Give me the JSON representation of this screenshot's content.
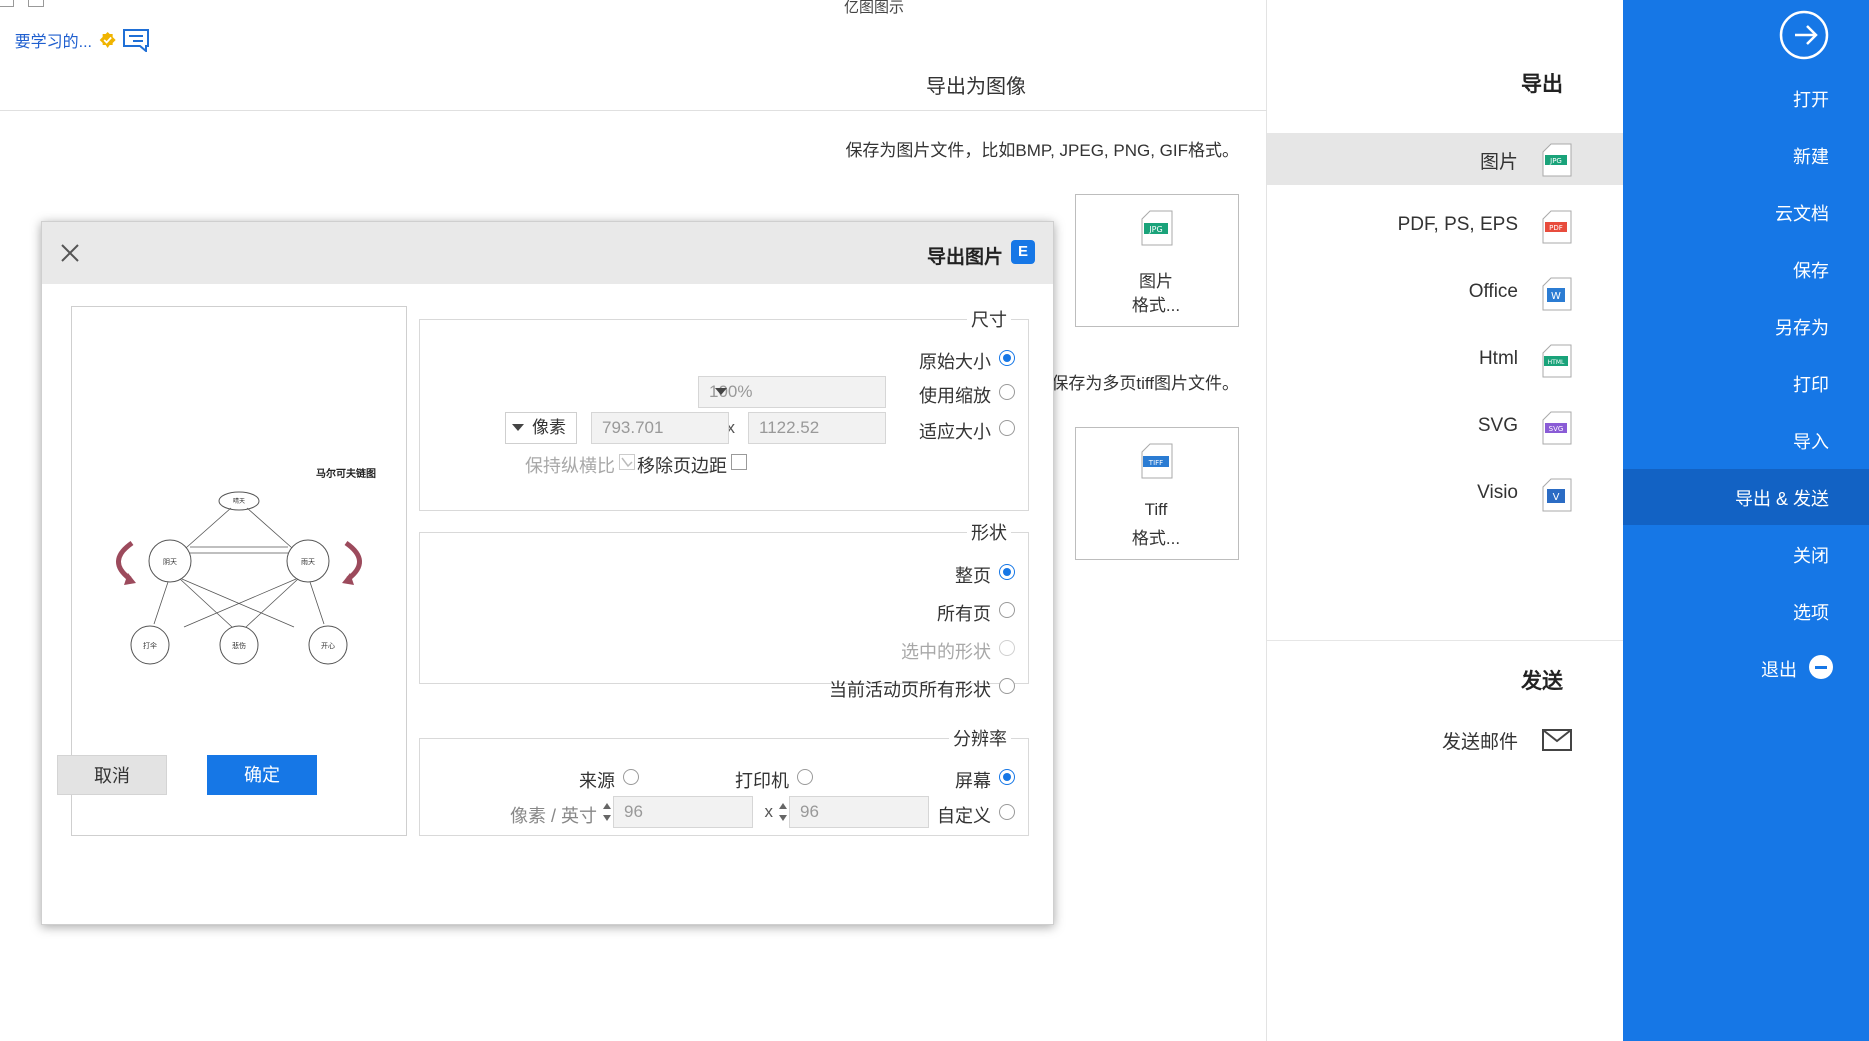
{
  "window": {
    "title": "亿图图示"
  },
  "top_bar": {
    "learn_link": "要学习的..."
  },
  "sidebar": {
    "items": [
      {
        "label": "打开"
      },
      {
        "label": "新建"
      },
      {
        "label": "云文档"
      },
      {
        "label": "保存"
      },
      {
        "label": "另存为"
      },
      {
        "label": "打印"
      },
      {
        "label": "导入"
      },
      {
        "label": "导出 & 发送"
      },
      {
        "label": "关闭"
      },
      {
        "label": "选项"
      },
      {
        "label": "退出"
      }
    ],
    "active_index": 7
  },
  "export_panel": {
    "heading": "导出",
    "formats": [
      {
        "label": "图片",
        "icon": "JPG",
        "color": "#1aa37a"
      },
      {
        "label": "PDF, PS, EPS",
        "icon": "PDF",
        "color": "#e84c3d"
      },
      {
        "label": "Office",
        "icon": "W",
        "color": "#2b7cd3"
      },
      {
        "label": "Html",
        "icon": "HTML",
        "color": "#1aa37a"
      },
      {
        "label": "SVG",
        "icon": "SVG",
        "color": "#8a5cd6"
      },
      {
        "label": "Visio",
        "icon": "V",
        "color": "#2b6cc4"
      }
    ],
    "send_heading": "发送",
    "send_mail": "发送邮件"
  },
  "content": {
    "heading": "导出为图像",
    "desc_image": "保存为图片文件，比如BMP, JPEG, PNG, GIF格式。",
    "desc_tiff": "保存为多页tiff图片文件。",
    "card_image": {
      "line1": "图片",
      "line2": "格式...",
      "icon": "JPG"
    },
    "card_tiff": {
      "line1": "Tiff",
      "line2": "格式...",
      "icon": "TIFF"
    }
  },
  "dialog": {
    "title": "导出图片",
    "size": {
      "title": "尺寸",
      "opt_original": "原始大小",
      "opt_scale": "使用缩放",
      "opt_fit": "适应大小",
      "scale_value": "100%",
      "width": "1122.52",
      "height": "793.701",
      "unit": "像素",
      "remove_margin": "移除页边距",
      "keep_ratio": "保持纵横比",
      "x_sep": "x"
    },
    "shape": {
      "title": "形状",
      "opt_page": "整页",
      "opt_all": "所有页",
      "opt_selected": "选中的形状",
      "opt_current_all": "当前活动页所有形状"
    },
    "resolution": {
      "title": "分辨率",
      "opt_screen": "屏幕",
      "opt_printer": "打印机",
      "opt_source": "来源",
      "opt_custom": "自定义",
      "dpi_x": "96",
      "dpi_y": "96",
      "unit": "像素 / 英寸",
      "x_sep": "x"
    },
    "preview": {
      "title": "马尔可夫链图",
      "nodes": [
        "晴天",
        "雨天",
        "阴天",
        "开心",
        "悲伤",
        "打伞"
      ]
    },
    "ok_label": "确定",
    "cancel_label": "取消"
  }
}
